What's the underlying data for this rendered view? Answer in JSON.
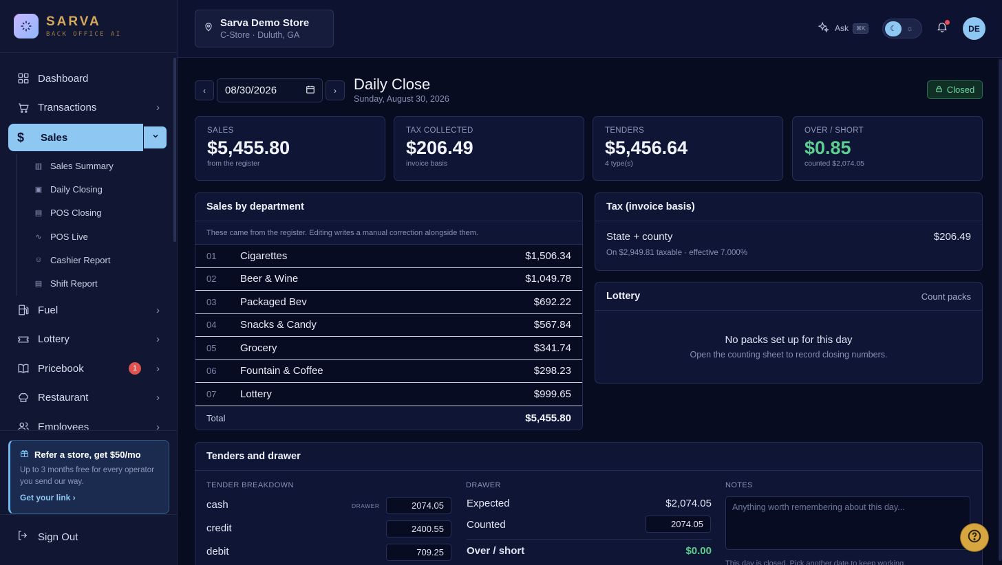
{
  "brand": {
    "name": "SARVA",
    "tagline": "BACK OFFICE AI"
  },
  "nav": {
    "items_top": [
      {
        "label": "Dashboard",
        "icon": "grid-icon"
      },
      {
        "label": "Transactions",
        "icon": "cart-icon"
      }
    ],
    "active": {
      "label": "Sales",
      "icon": "dollar-icon"
    },
    "sub_items": [
      {
        "label": "Sales Summary",
        "icon": "bar-chart-icon"
      },
      {
        "label": "Daily Closing",
        "icon": "clipboard-icon"
      },
      {
        "label": "POS Closing",
        "icon": "receipt-icon"
      },
      {
        "label": "POS Live",
        "icon": "activity-icon"
      },
      {
        "label": "Cashier Report",
        "icon": "user-icon"
      },
      {
        "label": "Shift Report",
        "icon": "document-icon"
      }
    ],
    "items_bottom": [
      {
        "label": "Fuel",
        "icon": "fuel-icon"
      },
      {
        "label": "Lottery",
        "icon": "ticket-icon"
      },
      {
        "label": "Pricebook",
        "icon": "book-icon",
        "badge": "1"
      },
      {
        "label": "Restaurant",
        "icon": "chef-hat-icon"
      },
      {
        "label": "Employees",
        "icon": "users-icon"
      }
    ]
  },
  "refer": {
    "title": "Refer a store, get $50/mo",
    "desc": "Up to 3 months free for every operator you send our way.",
    "link": "Get your link"
  },
  "signout": "Sign Out",
  "store": {
    "name": "Sarva Demo Store",
    "sub": "C-Store · Duluth, GA"
  },
  "topbar": {
    "ask": "Ask",
    "ask_kbd": "⌘K",
    "avatar": "DE"
  },
  "page": {
    "date": "08/30/2026",
    "title": "Daily Close",
    "subtitle": "Sunday, August 30, 2026",
    "status": "Closed"
  },
  "stats": [
    {
      "label": "SALES",
      "value": "$5,455.80",
      "sub": "from the register"
    },
    {
      "label": "TAX COLLECTED",
      "value": "$206.49",
      "sub": "invoice basis"
    },
    {
      "label": "TENDERS",
      "value": "$5,456.64",
      "sub": "4 type(s)"
    },
    {
      "label": "OVER / SHORT",
      "value": "$0.85",
      "sub": "counted $2,074.05"
    }
  ],
  "departments": {
    "title": "Sales by department",
    "note": "These came from the register. Editing writes a manual correction alongside them.",
    "rows": [
      {
        "num": "01",
        "name": "Cigarettes",
        "amount": "$1,506.34"
      },
      {
        "num": "02",
        "name": "Beer & Wine",
        "amount": "$1,049.78"
      },
      {
        "num": "03",
        "name": "Packaged Bev",
        "amount": "$692.22"
      },
      {
        "num": "04",
        "name": "Snacks & Candy",
        "amount": "$567.84"
      },
      {
        "num": "05",
        "name": "Grocery",
        "amount": "$341.74"
      },
      {
        "num": "06",
        "name": "Fountain & Coffee",
        "amount": "$298.23"
      },
      {
        "num": "07",
        "name": "Lottery",
        "amount": "$999.65"
      }
    ],
    "total_label": "Total",
    "total_value": "$5,455.80"
  },
  "tax": {
    "title": "Tax (invoice basis)",
    "line_label": "State + county",
    "line_value": "$206.49",
    "note": "On $2,949.81 taxable · effective 7.000%"
  },
  "lottery": {
    "title": "Lottery",
    "action": "Count packs",
    "empty_title": "No packs set up for this day",
    "empty_sub": "Open the counting sheet to record closing numbers."
  },
  "tenders": {
    "title": "Tenders and drawer",
    "breakdown_label": "TENDER BREAKDOWN",
    "drawer_label": "DRAWER",
    "notes_label": "NOTES",
    "drawer_tag": "DRAWER",
    "rows": [
      {
        "name": "cash",
        "value": "2074.05"
      },
      {
        "name": "credit",
        "value": "2400.55"
      },
      {
        "name": "debit",
        "value": "709.25"
      }
    ],
    "expected_label": "Expected",
    "expected_value": "$2,074.05",
    "counted_label": "Counted",
    "counted_value": "2074.05",
    "over_short_label": "Over / short",
    "over_short_value": "$0.00",
    "notes_placeholder": "Anything worth remembering about this day...",
    "notes_footer": "This day is closed. Pick another date to keep working."
  },
  "colors": {
    "accent": "#8ec7f2",
    "brand": "#d6a85c",
    "positive": "#5fcf91",
    "danger": "#e0524f"
  }
}
